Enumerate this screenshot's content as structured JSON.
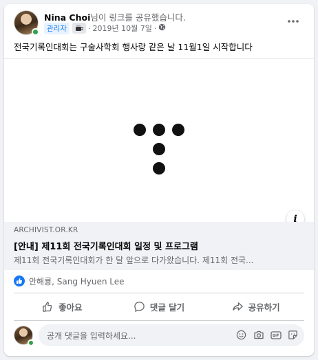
{
  "post": {
    "author_name": "Nina Choi",
    "author_action": "님이 링크를 공유했습니다.",
    "role_badge": "관리자",
    "date": "2019년 10월 7일",
    "separator_before_date": "·",
    "separator_after_date": "·",
    "privacy_icon": "globe-icon",
    "text": "전국기록인대회는 구술사학회 행사랑 같은 날 11월1일 시작합니다"
  },
  "link_preview": {
    "domain": "ARCHIVIST.OR.KR",
    "title": "[안내] 제11회 전국기록인대회 일정 및 프로그램",
    "description": "제11회 전국기록인대회가 한 달 앞으로 다가왔습니다. 제11회 전국...",
    "info_label": "i"
  },
  "reactions": {
    "names": "안해룡, Sang Hyuen Lee",
    "icon": "like-icon"
  },
  "actions": {
    "like_label": "좋아요",
    "comment_label": "댓글 달기",
    "share_label": "공유하기"
  },
  "comment_box": {
    "placeholder": "공개 댓글을 입력하세요..."
  },
  "colors": {
    "accent": "#1877f2",
    "secondary_text": "#65676b",
    "online": "#31a24c",
    "background": "#f0f2f5"
  }
}
